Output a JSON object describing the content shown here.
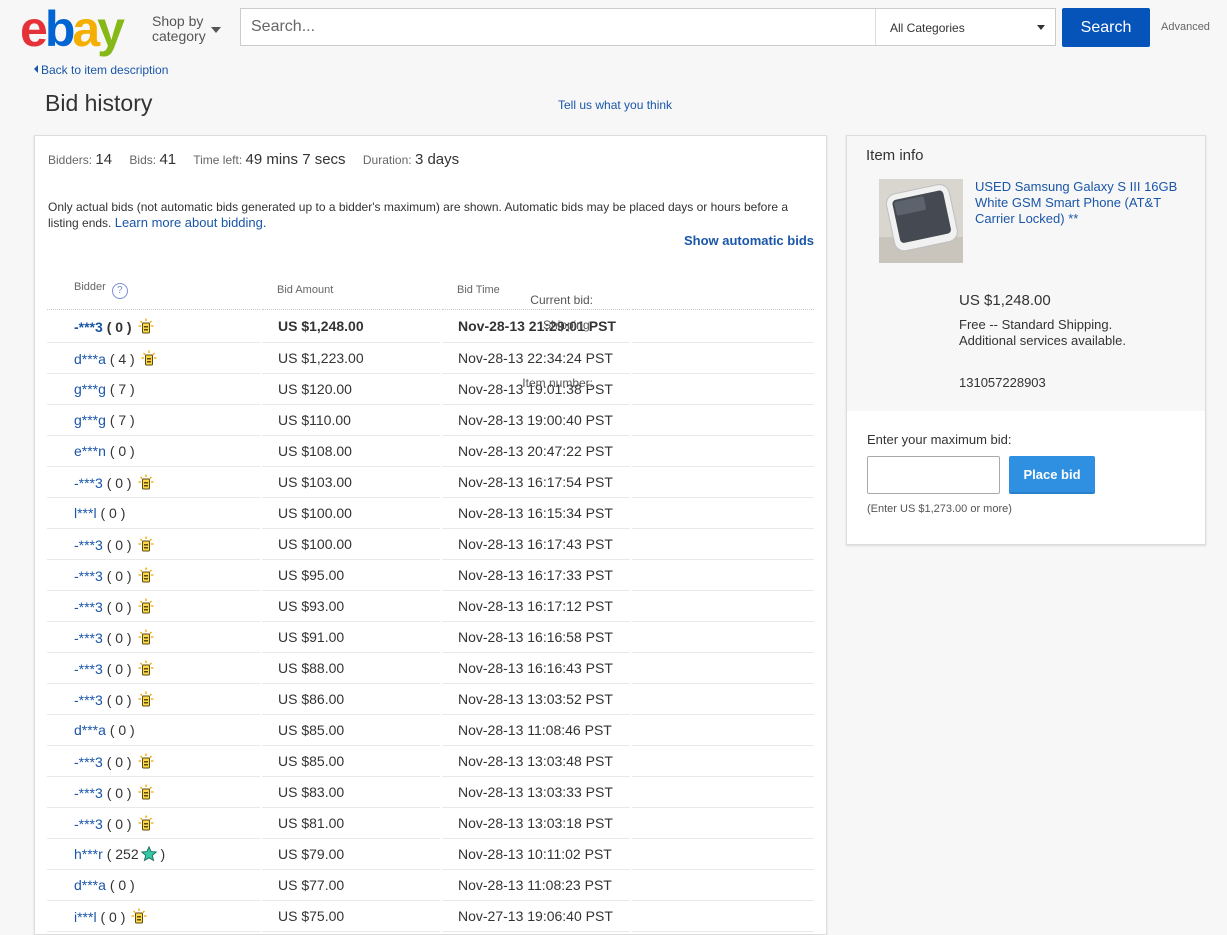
{
  "header": {
    "logo_text": "ebay",
    "shop_by_category": [
      "Shop by",
      "category"
    ],
    "search_placeholder": "Search...",
    "category_selected": "All Categories",
    "search_button": "Search",
    "advanced_link": "Advanced"
  },
  "nav": {
    "back_link": "Back to item description",
    "page_title": "Bid history",
    "feedback_link": "Tell us what you think"
  },
  "summary": {
    "bidders_label": "Bidders:",
    "bidders": "14",
    "bids_label": "Bids:",
    "bids": "41",
    "time_left_label": "Time left:",
    "time_left": "49 mins 7 secs",
    "duration_label": "Duration:",
    "duration": "3 days"
  },
  "note": {
    "text": "Only actual bids (not automatic bids generated up to a bidder's maximum) are shown. Automatic bids may be placed days or hours before a listing ends.",
    "learn_more": "Learn more about bidding.",
    "show_automatic": "Show automatic bids"
  },
  "table": {
    "headers": [
      "Bidder",
      "Bid Amount",
      "Bid Time"
    ],
    "rows": [
      {
        "bidder": "-***3",
        "score": "0",
        "icon": "sun-icon",
        "amount": "US $1,248.00",
        "time": "Nov-28-13 21:29:01 PST"
      },
      {
        "bidder": "d***a",
        "score": "4",
        "icon": "sun-icon",
        "amount": "US $1,223.00",
        "time": "Nov-28-13 22:34:24 PST"
      },
      {
        "bidder": "g***g",
        "score": "7",
        "icon": "",
        "amount": "US $120.00",
        "time": "Nov-28-13 19:01:38 PST"
      },
      {
        "bidder": "g***g",
        "score": "7",
        "icon": "",
        "amount": "US $110.00",
        "time": "Nov-28-13 19:00:40 PST"
      },
      {
        "bidder": "e***n",
        "score": "0",
        "icon": "",
        "amount": "US $108.00",
        "time": "Nov-28-13 20:47:22 PST"
      },
      {
        "bidder": "-***3",
        "score": "0",
        "icon": "sun-icon",
        "amount": "US $103.00",
        "time": "Nov-28-13 16:17:54 PST"
      },
      {
        "bidder": "l***l",
        "score": "0",
        "icon": "",
        "amount": "US $100.00",
        "time": "Nov-28-13 16:15:34 PST"
      },
      {
        "bidder": "-***3",
        "score": "0",
        "icon": "sun-icon",
        "amount": "US $100.00",
        "time": "Nov-28-13 16:17:43 PST"
      },
      {
        "bidder": "-***3",
        "score": "0",
        "icon": "sun-icon",
        "amount": "US $95.00",
        "time": "Nov-28-13 16:17:33 PST"
      },
      {
        "bidder": "-***3",
        "score": "0",
        "icon": "sun-icon",
        "amount": "US $93.00",
        "time": "Nov-28-13 16:17:12 PST"
      },
      {
        "bidder": "-***3",
        "score": "0",
        "icon": "sun-icon",
        "amount": "US $91.00",
        "time": "Nov-28-13 16:16:58 PST"
      },
      {
        "bidder": "-***3",
        "score": "0",
        "icon": "sun-icon",
        "amount": "US $88.00",
        "time": "Nov-28-13 16:16:43 PST"
      },
      {
        "bidder": "-***3",
        "score": "0",
        "icon": "sun-icon",
        "amount": "US $86.00",
        "time": "Nov-28-13 13:03:52 PST"
      },
      {
        "bidder": "d***a",
        "score": "0",
        "icon": "",
        "amount": "US $85.00",
        "time": "Nov-28-13 11:08:46 PST"
      },
      {
        "bidder": "-***3",
        "score": "0",
        "icon": "sun-icon",
        "amount": "US $85.00",
        "time": "Nov-28-13 13:03:48 PST"
      },
      {
        "bidder": "-***3",
        "score": "0",
        "icon": "sun-icon",
        "amount": "US $83.00",
        "time": "Nov-28-13 13:03:33 PST"
      },
      {
        "bidder": "-***3",
        "score": "0",
        "icon": "sun-icon",
        "amount": "US $81.00",
        "time": "Nov-28-13 13:03:18 PST"
      },
      {
        "bidder": "h***r",
        "score": "252",
        "icon": "star-icon",
        "amount": "US $79.00",
        "time": "Nov-28-13 10:11:02 PST"
      },
      {
        "bidder": "d***a",
        "score": "0",
        "icon": "",
        "amount": "US $77.00",
        "time": "Nov-28-13 11:08:23 PST"
      },
      {
        "bidder": "i***l",
        "score": "0",
        "icon": "sun-icon",
        "amount": "US $75.00",
        "time": "Nov-27-13 19:06:40 PST"
      }
    ]
  },
  "item": {
    "section_title": "Item info",
    "title": "USED Samsung Galaxy S III 16GB White GSM Smart Phone (AT&T Carrier Locked) **",
    "current_bid_label": "Current bid:",
    "current_bid": "US $1,248.00",
    "shipping_label": "Shipping:",
    "shipping": "Free -- Standard Shipping.  Additional services available.",
    "item_number_label": "Item number:",
    "item_number": "131057228903",
    "enter_max_label": "Enter your maximum bid:",
    "place_bid": "Place bid",
    "enter_hint": "(Enter US $1,273.00 or more)"
  },
  "colors": {
    "accent": "#0654ba",
    "link": "#1a56a8",
    "place_bid": "#2f8fe0"
  }
}
